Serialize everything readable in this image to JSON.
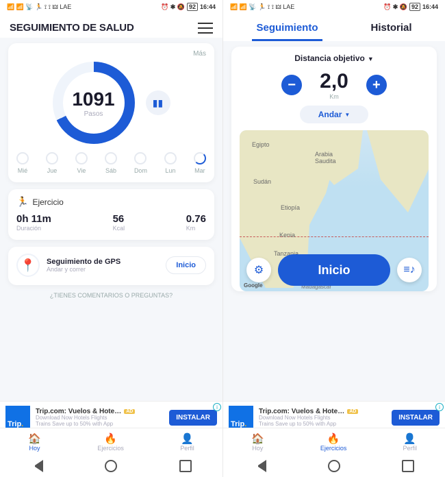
{
  "status": {
    "battery": "92",
    "time": "16:44"
  },
  "left": {
    "title": "SEGUIMIENTO DE SALUD",
    "more": "Más",
    "steps": {
      "value": "1091",
      "label": "Pasos"
    },
    "days": [
      "Mié",
      "Jue",
      "Vie",
      "Sáb",
      "Dom",
      "Lun",
      "Mar"
    ],
    "exercise": {
      "title": "Ejercicio",
      "duration_v": "0h 11m",
      "duration_l": "Duración",
      "kcal_v": "56",
      "kcal_l": "Kcal",
      "km_v": "0.76",
      "km_l": "Km"
    },
    "gps": {
      "title": "Seguimiento de GPS",
      "sub": "Andar y correr",
      "btn": "Inicio"
    },
    "feedback": "¿TIENES COMENTARIOS O PREGUNTAS?"
  },
  "right": {
    "tabs": {
      "a": "Seguimiento",
      "b": "Historial"
    },
    "target_label": "Distancia objetivo",
    "dist": {
      "value": "2,0",
      "unit": "Km"
    },
    "mode": "Andar",
    "start": "Inicio",
    "map_labels": {
      "egipto": "Egipto",
      "arabia": "Arabia\nSaudita",
      "sudan": "Sudán",
      "etiopia": "Etiopía",
      "kenia": "Kenia",
      "tanzania": "Tanzania",
      "google": "Google",
      "madagascar": "Madagascar"
    }
  },
  "ad": {
    "logo": "Trip",
    "title": "Trip.com: Vuelos & Hote…",
    "sub1": "Download Now Hotels Flights",
    "sub2": "Trains Save up to 50% with App",
    "install": "INSTALAR",
    "badge": "AD"
  },
  "nav": {
    "hoy": "Hoy",
    "ejercicios": "Ejercicios",
    "perfil": "Perfil"
  }
}
